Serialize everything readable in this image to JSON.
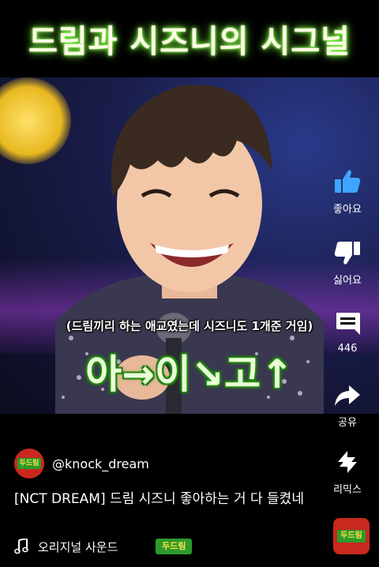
{
  "header": {
    "overlay_title": "드림과 시즈니의 시그널"
  },
  "video": {
    "caption_small": "(드림끼리 하는 애교였는데 시즈니도 1개준 거임)",
    "caption_big": "아→이↘고↑"
  },
  "actions": {
    "like_label": "좋아요",
    "dislike_label": "싫어요",
    "comments_count": "446",
    "share_label": "공유",
    "remix_label": "리믹스"
  },
  "channel": {
    "handle": "@knock_dream",
    "avatar_text": "두드림"
  },
  "video_info": {
    "title": "[NCT DREAM] 드림 시즈니 좋아하는 거 다 들켰네"
  },
  "sound": {
    "label": "오리지널 사운드",
    "thumb_text": "두드림"
  },
  "colors": {
    "accent_green": "#2c9a2a",
    "brand_red": "#c8281e",
    "title_glow": "#8cff5a"
  }
}
